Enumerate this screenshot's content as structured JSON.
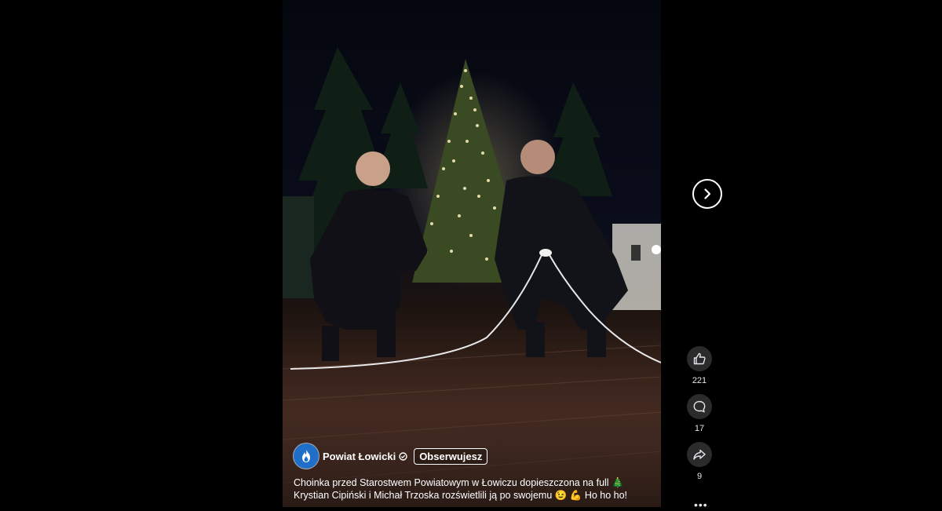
{
  "post": {
    "author_name": "Powiat Łowicki",
    "follow_label": "Obserwujesz",
    "caption_line1": "Choinka przed Starostwem Powiatowym w Łowiczu dopieszczona na full 🎄",
    "caption_line2": "Krystian Cipiński i Michał Trzoska rozświetlili ją po swojemu 😉 💪 Ho ho ho!"
  },
  "actions": {
    "like_count": "221",
    "comment_count": "17",
    "share_count": "9"
  },
  "icons": {
    "next": "chevron-right-icon",
    "like": "thumbs-up-icon",
    "comment": "comment-bubble-icon",
    "share": "share-arrow-icon",
    "more": "more-dots-icon",
    "verified": "verified-badge-icon",
    "avatar": "fire-logo-icon"
  },
  "colors": {
    "page_bg": "#000000",
    "action_circle": "#2b2b2b",
    "avatar_bg": "#1f6fc9",
    "text": "#ffffff"
  }
}
